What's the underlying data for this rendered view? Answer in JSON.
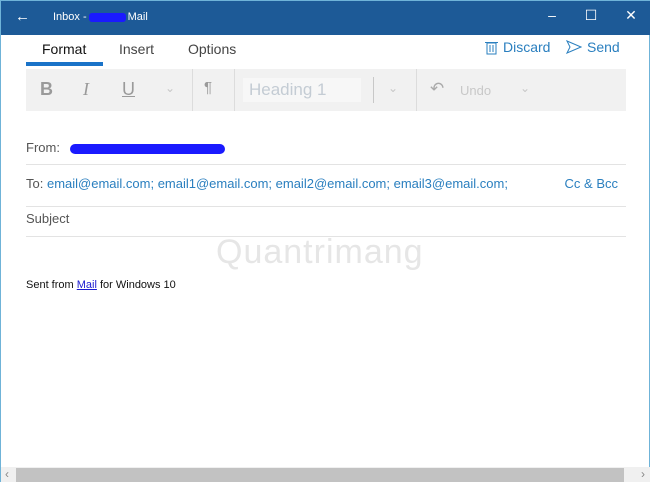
{
  "window": {
    "title_prefix": "Inbox -",
    "title_suffix": "Mail",
    "back": "←",
    "minimize": "–",
    "maximize": "☐",
    "close": "✕"
  },
  "tabs": [
    {
      "label": "Format"
    },
    {
      "label": "Insert"
    },
    {
      "label": "Options"
    }
  ],
  "actions": {
    "discard": "Discard",
    "send": "Send"
  },
  "toolbar": {
    "bold": "B",
    "italic": "I",
    "underline": "U",
    "style": "Heading 1",
    "undo": "Undo"
  },
  "compose": {
    "from_label": "From:",
    "to_label": "To:",
    "to": "email@email.com; email1@email.com; email2@email.com; email3@email.com;",
    "cc_bcc": "Cc & Bcc",
    "subject_placeholder": "Subject"
  },
  "body": {
    "prefix": "Sent from ",
    "link": "Mail",
    "suffix": " for Windows 10"
  },
  "watermark": "Quantrimang"
}
